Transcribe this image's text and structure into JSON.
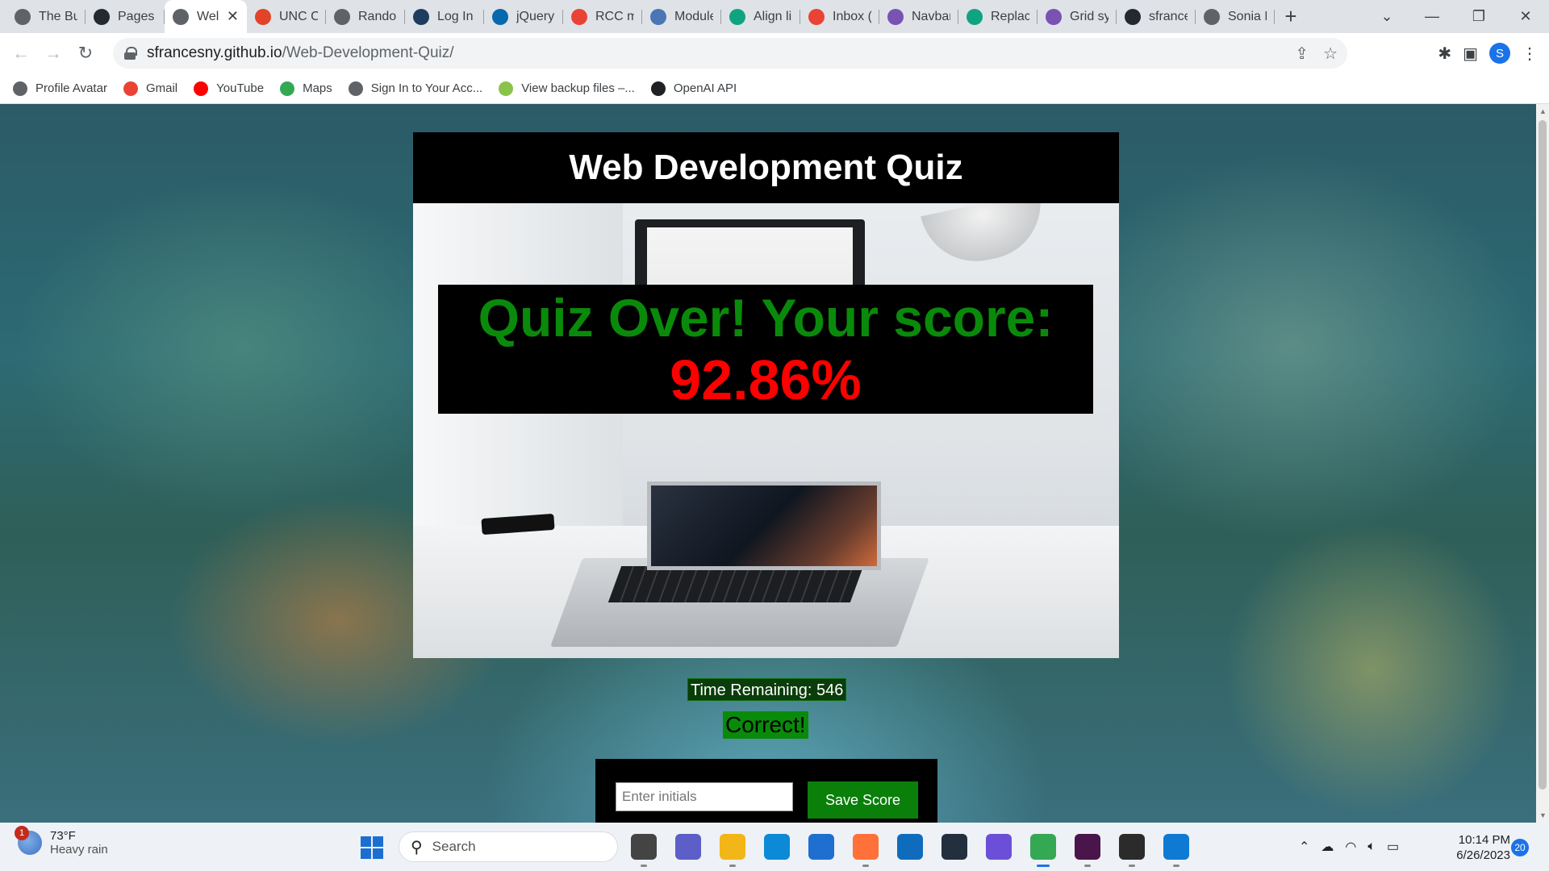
{
  "browser": {
    "tabs": [
      {
        "title": "The Bu",
        "icon": "document-icon",
        "color": "#5f6368"
      },
      {
        "title": "Pages",
        "icon": "github-icon",
        "color": "#24292f"
      },
      {
        "title": "Wel",
        "icon": "globe-icon",
        "color": "#5f6368",
        "active": true
      },
      {
        "title": "UNC Cl",
        "icon": "gitlab-icon",
        "color": "#e24329"
      },
      {
        "title": "Randol",
        "icon": "globe-icon",
        "color": "#5f6368"
      },
      {
        "title": "Log In",
        "icon": "fsa-icon",
        "color": "#1d3c5e"
      },
      {
        "title": "jQuery",
        "icon": "jquery-icon",
        "color": "#0769ad"
      },
      {
        "title": "RCC my",
        "icon": "gmail-icon",
        "color": "#ea4335"
      },
      {
        "title": "Module",
        "icon": "document-icon",
        "color": "#4a76b5"
      },
      {
        "title": "Align li",
        "icon": "chatgpt-icon",
        "color": "#10a37f"
      },
      {
        "title": "Inbox (",
        "icon": "gmail-icon",
        "color": "#ea4335"
      },
      {
        "title": "Navbar",
        "icon": "bootstrap-icon",
        "color": "#7952b3"
      },
      {
        "title": "Replace",
        "icon": "chatgpt-icon",
        "color": "#10a37f"
      },
      {
        "title": "Grid sy",
        "icon": "bootstrap-icon",
        "color": "#7952b3"
      },
      {
        "title": "sfrance",
        "icon": "github-icon",
        "color": "#24292f"
      },
      {
        "title": "Sonia F",
        "icon": "globe-icon",
        "color": "#5f6368"
      }
    ],
    "url_host": "sfrancesny.github.io",
    "url_path": "/Web-Development-Quiz/",
    "profile_initial": "S",
    "bookmarks": [
      {
        "label": "Profile Avatar",
        "icon": "globe-icon",
        "color": "#5f6368"
      },
      {
        "label": "Gmail",
        "icon": "gmail-icon",
        "color": "#ea4335"
      },
      {
        "label": "YouTube",
        "icon": "youtube-icon",
        "color": "#ff0000"
      },
      {
        "label": "Maps",
        "icon": "maps-icon",
        "color": "#34a853"
      },
      {
        "label": "Sign In to Your Acc...",
        "icon": "globe-icon",
        "color": "#5f6368"
      },
      {
        "label": "View backup files –...",
        "icon": "backup-icon",
        "color": "#8bc34a"
      },
      {
        "label": "OpenAI API",
        "icon": "openai-icon",
        "color": "#202124"
      }
    ]
  },
  "quiz": {
    "title": "Web Development Quiz",
    "result_line": "Quiz Over! Your score:",
    "score": "92.86%",
    "timer_text": "Time Remaining: 546",
    "feedback": "Correct!",
    "initials_placeholder": "Enter initials",
    "save_label": "Save Score",
    "colors": {
      "score_text": "#0a8a0a",
      "score_value": "#ff0000",
      "save_button": "#0a7f0a"
    }
  },
  "taskbar": {
    "weather_temp": "73°F",
    "weather_desc": "Heavy rain",
    "weather_badge": "1",
    "search_label": "Search",
    "apps": [
      {
        "name": "task-view-icon",
        "color": "#444"
      },
      {
        "name": "teams-chat-icon",
        "color": "#5b5fc7"
      },
      {
        "name": "file-explorer-icon",
        "color": "#f2b619"
      },
      {
        "name": "edge-icon",
        "color": "#0c8ad8"
      },
      {
        "name": "microsoft-store-icon",
        "color": "#1f6fd0"
      },
      {
        "name": "firefox-icon",
        "color": "#ff7139"
      },
      {
        "name": "mail-icon",
        "color": "#0f6cbd"
      },
      {
        "name": "amazon-icon",
        "color": "#232f3e"
      },
      {
        "name": "copilot-icon",
        "color": "#6b4fd8"
      },
      {
        "name": "chrome-icon",
        "color": "#34a853"
      },
      {
        "name": "slack-icon",
        "color": "#4a154b"
      },
      {
        "name": "terminal-icon",
        "color": "#2b2b2b"
      },
      {
        "name": "vscode-icon",
        "color": "#0e7ad4"
      }
    ],
    "clock_time": "10:14 PM",
    "clock_date": "6/26/2023",
    "notifications": "20"
  }
}
